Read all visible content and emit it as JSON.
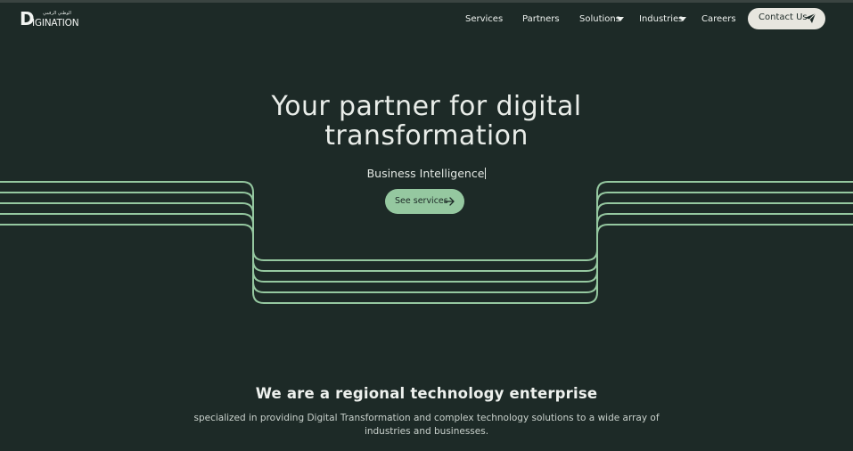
{
  "brand": {
    "logo_mark": "D",
    "logo_word": "IGINATION",
    "logo_arabic": "الوطني الرقمي",
    "line_color": "#95c8a0",
    "background": "#1d2a27"
  },
  "nav": {
    "items": [
      {
        "label": "Services",
        "has_dropdown": false
      },
      {
        "label": "Partners",
        "has_dropdown": false
      },
      {
        "label": "Solutions",
        "has_dropdown": true
      },
      {
        "label": "Industries",
        "has_dropdown": true
      },
      {
        "label": "Careers",
        "has_dropdown": false
      }
    ],
    "contact_label": "Contact Us",
    "contact_icon": "send-icon"
  },
  "hero": {
    "title_line1": "Your partner for digital",
    "title_line2": "transformation",
    "typing_text": "Business Intelligence",
    "cta_label": "See services",
    "cta_icon": "arrow-right-icon"
  },
  "about": {
    "title": "We are a regional technology enterprise",
    "text": "specialized in providing Digital Transformation and complex technology solutions to a wide array of industries and businesses."
  }
}
